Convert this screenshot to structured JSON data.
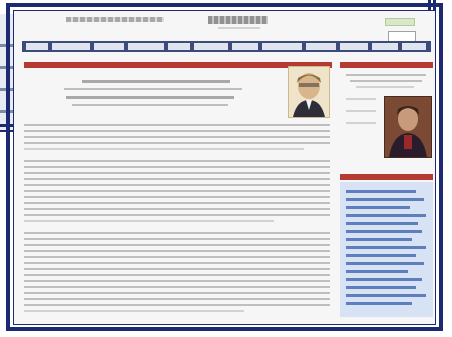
{
  "masthead": {
    "site_title": "",
    "site_tagline": "",
    "top_badge_label": "",
    "search_placeholder": ""
  },
  "nav": {
    "items": [
      "",
      "",
      "",
      "",
      "",
      "",
      "",
      "",
      "",
      "",
      "",
      ""
    ]
  },
  "article": {
    "section_heading": "",
    "headline": "",
    "subheadline": "",
    "body": ""
  },
  "sidebar": {
    "top_heading": "",
    "caption": "",
    "links_heading": "",
    "links": []
  },
  "colors": {
    "frame": "#1b2a72",
    "section_bar": "#b43a32",
    "nav_bar": "#3a4b7c",
    "sidebar_bg": "#d7e3f4"
  }
}
